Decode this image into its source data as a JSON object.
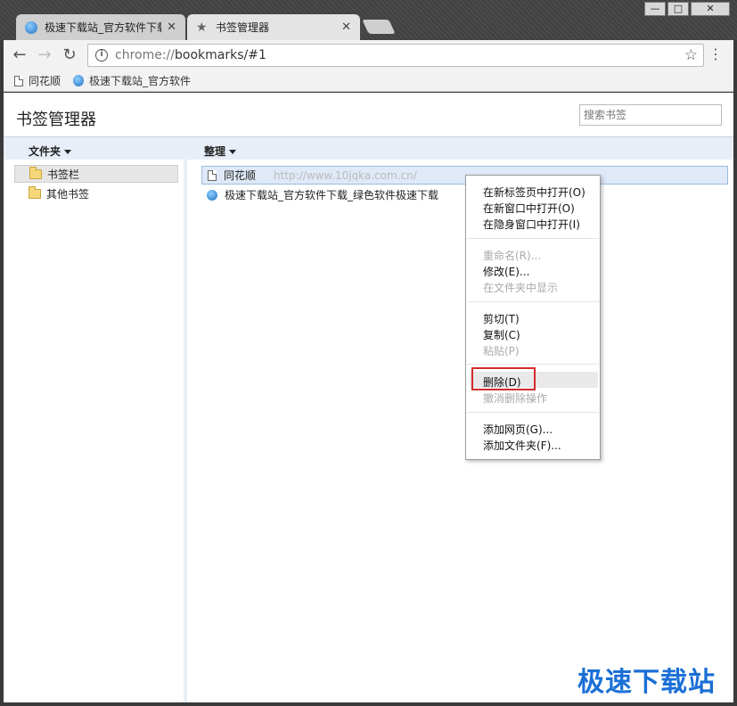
{
  "window": {
    "minimize": "—",
    "maximize": "□",
    "close": "✕"
  },
  "tabs": [
    {
      "label": "极速下载站_官方软件下载",
      "close": "✕",
      "active": false
    },
    {
      "label": "书签管理器",
      "close": "✕",
      "active": true
    }
  ],
  "toolbar": {
    "back": "←",
    "forward": "→",
    "reload": "↻",
    "info": "i",
    "url_scheme": "chrome://",
    "url_rest": "bookmarks/#1",
    "star": "☆",
    "menu": "⋮"
  },
  "bookmark_bar": [
    {
      "label": "同花顺"
    },
    {
      "label": "极速下载站_官方软件"
    }
  ],
  "page": {
    "title": "书签管理器",
    "search_placeholder": "搜索书签"
  },
  "columns": {
    "folders_label": "文件夹",
    "organize_label": "整理"
  },
  "folders": [
    {
      "label": "书签栏",
      "selected": true
    },
    {
      "label": "其他书签",
      "selected": false
    }
  ],
  "bookmarks": [
    {
      "title": "同花顺",
      "url": "http://www.10jqka.com.cn/",
      "selected": true
    },
    {
      "title": "极速下载站_官方软件下载_绿色软件极速下载",
      "url": "",
      "selected": false
    }
  ],
  "context_menu": {
    "items": [
      {
        "label": "在新标签页中打开(O)",
        "disabled": false
      },
      {
        "label": "在新窗口中打开(O)",
        "disabled": false
      },
      {
        "label": "在隐身窗口中打开(I)",
        "disabled": false
      },
      {
        "label": "重命名(R)...",
        "disabled": true
      },
      {
        "label": "修改(E)...",
        "disabled": false
      },
      {
        "label": "在文件夹中显示",
        "disabled": true
      },
      {
        "label": "剪切(T)",
        "disabled": false
      },
      {
        "label": "复制(C)",
        "disabled": false
      },
      {
        "label": "粘贴(P)",
        "disabled": true
      },
      {
        "label": "删除(D)",
        "disabled": false,
        "highlighted": true
      },
      {
        "label": "撤消删除操作",
        "disabled": true
      },
      {
        "label": "添加网页(G)...",
        "disabled": false
      },
      {
        "label": "添加文件夹(F)...",
        "disabled": false
      }
    ]
  },
  "watermark": "极速下载站",
  "colors": {
    "highlight_border": "#d32c2c",
    "selection_bg": "#dfe9f7",
    "header_bg": "#e8eef7",
    "watermark": "#1a6fd6"
  }
}
